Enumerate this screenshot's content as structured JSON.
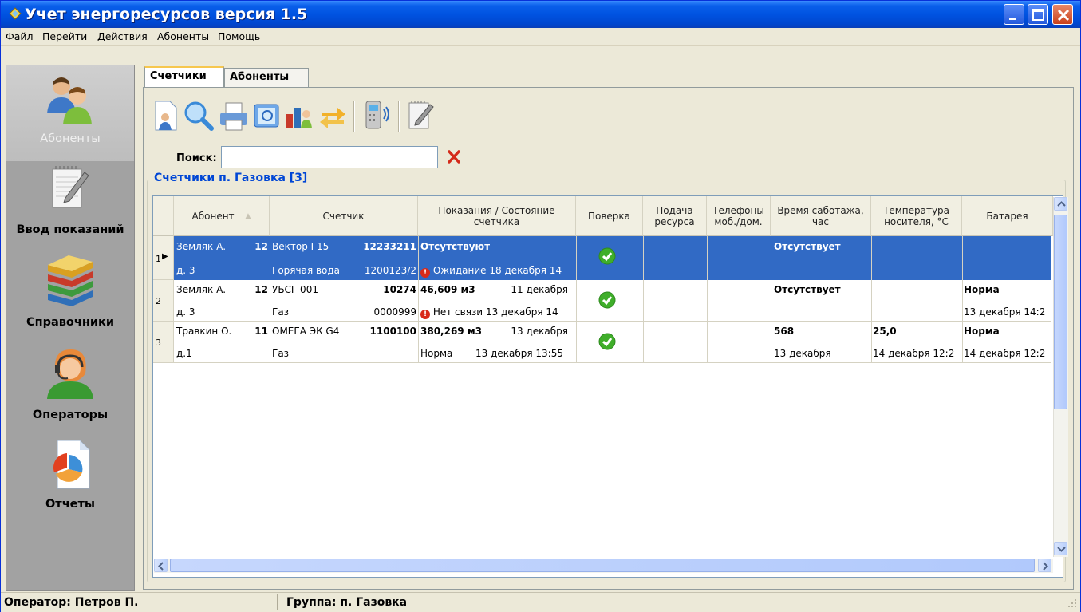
{
  "window": {
    "title": "Учет энергоресурсов версия 1.5",
    "accent": "#0A5FEA"
  },
  "menu": [
    "Файл",
    "Перейти",
    "Действия",
    "Абоненты",
    "Помощь"
  ],
  "nav": {
    "items": [
      {
        "label": "Абоненты",
        "icon": "users-icon",
        "active": true
      },
      {
        "label": "Ввод показаний",
        "icon": "notepad-pencil-icon"
      },
      {
        "label": "Справочники",
        "icon": "books-icon"
      },
      {
        "label": "Операторы",
        "icon": "operator-headset-icon"
      },
      {
        "label": "Отчеты",
        "icon": "report-pie-icon"
      }
    ]
  },
  "tabs": [
    {
      "label": "Счетчики",
      "active": true
    },
    {
      "label": "Абоненты",
      "active": false
    }
  ],
  "toolbar": {
    "icons": [
      "new-document-icon",
      "search-icon",
      "printer-icon",
      "preview-icon",
      "users-chart-icon",
      "refresh-icon",
      "meter-signal-icon",
      "edit-icon"
    ]
  },
  "search": {
    "label": "Поиск:",
    "value": "",
    "placeholder": ""
  },
  "group": {
    "title": "Счетчики п. Газовка [3]"
  },
  "grid": {
    "columns": [
      "Абонент",
      "Счетчик",
      "Показания / Состояние счетчика",
      "Поверка",
      "Подача ресурса",
      "Телефоны моб./дом.",
      "Время саботажа, час",
      "Температура носителя, °C",
      "Батарея"
    ],
    "rows": [
      {
        "num": "1",
        "abonent_name": "Земляк А.",
        "abonent_num": "12",
        "abonent_house": "д. 3",
        "meter_name": "Вектор Г15",
        "meter_id": "12233211",
        "meter_type": "Горячая вода",
        "meter_serial": "1200123/2",
        "reading": "Отсутствуют",
        "reading_date": "",
        "state_text": "Ожидание",
        "state_date": "18 декабря 14",
        "sabotage": "Отсутствует",
        "sabotage_date": "",
        "temp": "",
        "temp_date": "",
        "battery": "",
        "battery_date": ""
      },
      {
        "num": "2",
        "abonent_name": "Земляк А.",
        "abonent_num": "12",
        "abonent_house": "д. 3",
        "meter_name": "УБСГ 001",
        "meter_id": "10274",
        "meter_type": "Газ",
        "meter_serial": "0000999",
        "reading": "46,609 м3",
        "reading_date": "11 декабря",
        "state_text": "Нет связи",
        "state_date": "13 декабря 14",
        "sabotage": "Отсутствует",
        "sabotage_date": "",
        "temp": "",
        "temp_date": "",
        "battery": "Норма",
        "battery_date": "13 декабря 14:2"
      },
      {
        "num": "3",
        "abonent_name": "Травкин О.",
        "abonent_num": "11",
        "abonent_house": "д.1",
        "meter_name": "ОМЕГА ЭК G4",
        "meter_id": "1100100",
        "meter_type": "Газ",
        "meter_serial": "",
        "reading": "380,269 м3",
        "reading_date": "13 декабря",
        "state_text": "Норма",
        "state_date": "13 декабря 13:55",
        "sabotage": "568",
        "sabotage_date": "13 декабря",
        "temp": "25,0",
        "temp_date": "14 декабря 12:2",
        "battery": "Норма",
        "battery_date": "14 декабря 12:2"
      }
    ]
  },
  "status": {
    "operator": "Оператор: Петров П.",
    "group": "Группа: п. Газовка"
  }
}
